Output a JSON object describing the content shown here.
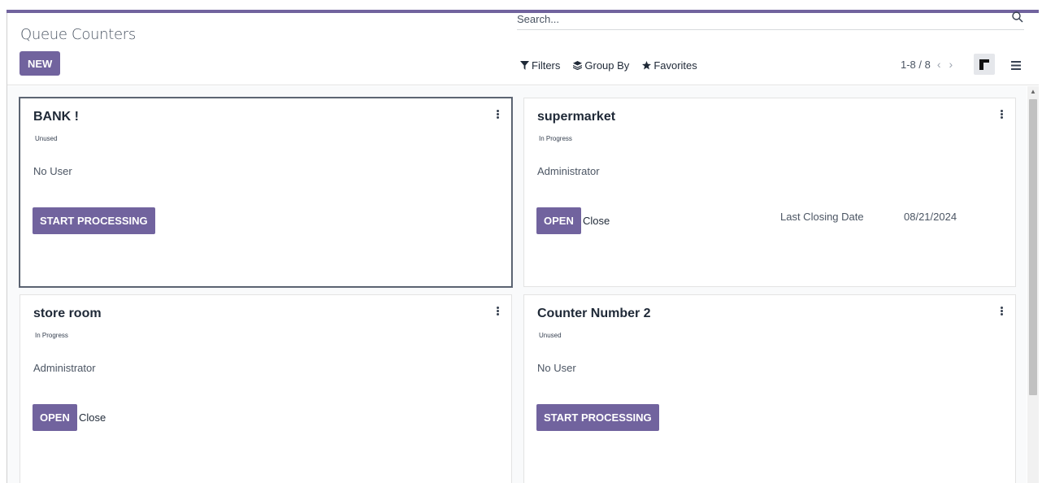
{
  "colors": {
    "accent": "#71639e",
    "border": "#e3e3e3",
    "text": "#374151"
  },
  "header": {
    "title": "Queue Counters",
    "new_label": "NEW"
  },
  "search": {
    "placeholder": "Search...",
    "icon": "search-icon"
  },
  "filters": {
    "filters_label": "Filters",
    "group_by_label": "Group By",
    "favorites_label": "Favorites"
  },
  "pager": {
    "value": "1-8 / 8",
    "prev": "‹",
    "next": "›"
  },
  "views": {
    "kanban": "kanban-view-icon",
    "list": "list-view-icon"
  },
  "cards": [
    {
      "name": "BANK !",
      "state": "Unused",
      "user": "No User",
      "primary_action": "START PROCESSING"
    },
    {
      "name": "supermarket",
      "state": "In Progress",
      "user": "Administrator",
      "primary_action": "OPEN",
      "secondary_action": "Close",
      "meta_label": "Last Closing Date",
      "meta_value": "08/21/2024"
    },
    {
      "name": "store room",
      "state": "In Progress",
      "user": "Administrator",
      "primary_action": "OPEN",
      "secondary_action": "Close"
    },
    {
      "name": "Counter Number 2",
      "state": "Unused",
      "user": "No User",
      "primary_action": "START PROCESSING"
    }
  ]
}
